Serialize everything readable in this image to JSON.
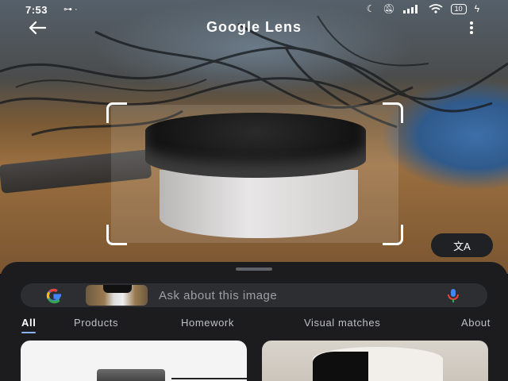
{
  "status_bar": {
    "time": "7:53",
    "left_icons": "⊶  ·",
    "battery": "10",
    "right_icons": [
      "moon-icon",
      "mute-icon",
      "signal-icon",
      "wifi-icon",
      "battery-icon",
      "charging-icon"
    ]
  },
  "app_bar": {
    "title": "Google Lens",
    "back_icon": "arrow-left-icon",
    "menu_icon": "more-vert-icon"
  },
  "translate_button": {
    "icon": "translate-icon",
    "glyph": "文A"
  },
  "search": {
    "placeholder": "Ask about this image",
    "logo": "google-g-icon",
    "mic_icon": "mic-icon"
  },
  "tabs": [
    {
      "label": "All",
      "active": true
    },
    {
      "label": "Products",
      "active": false
    },
    {
      "label": "Homework",
      "active": false
    },
    {
      "label": "Visual matches",
      "active": false
    },
    {
      "label": "About",
      "active": false
    }
  ],
  "colors": {
    "accent": "#8ab4f8",
    "sheet": "#1c1c1e",
    "search_bar": "#2d2e31"
  }
}
